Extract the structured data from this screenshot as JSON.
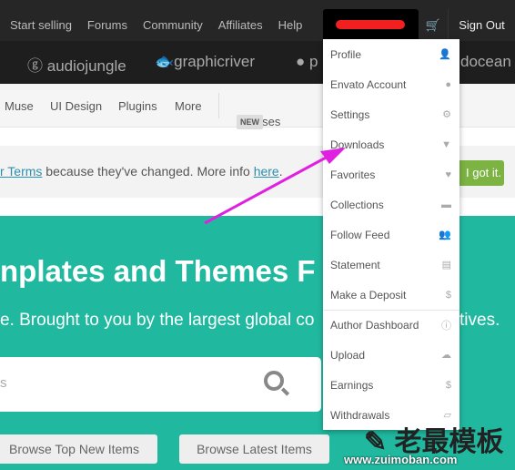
{
  "topbar": {
    "links": [
      "Start selling",
      "Forums",
      "Community",
      "Affiliates",
      "Help"
    ],
    "sign_out": "Sign Out"
  },
  "brands": [
    "audiojungle",
    "graphicriver",
    "p",
    "docean"
  ],
  "nav": {
    "items": [
      "Muse",
      "UI Design",
      "Plugins",
      "More"
    ],
    "courses": "Courses",
    "new_badge": "NEW"
  },
  "notice": {
    "link1": "r Terms",
    "middle": " because they've changed. More info ",
    "link2": "here",
    "end": ".",
    "button": "I got it."
  },
  "hero": {
    "title": "nplates and Themes F",
    "subtitle": "e. Brought to you by the largest global co",
    "subtitle_end": "tives.",
    "search_placeholder": "s",
    "btn_top": "Browse Top New Items",
    "btn_latest": "Browse Latest Items"
  },
  "menu": [
    {
      "label": "Profile",
      "icon": "user-icon",
      "glyph": "👤"
    },
    {
      "label": "Envato Account",
      "icon": "leaf-icon",
      "glyph": "●"
    },
    {
      "label": "Settings",
      "icon": "gear-icon",
      "glyph": "⚙"
    },
    {
      "label": "Downloads",
      "icon": "download-icon",
      "glyph": "▼"
    },
    {
      "label": "Favorites",
      "icon": "heart-icon",
      "glyph": "♥"
    },
    {
      "label": "Collections",
      "icon": "folder-icon",
      "glyph": "▬"
    },
    {
      "label": "Follow Feed",
      "icon": "follow-icon",
      "glyph": "👥"
    },
    {
      "label": "Statement",
      "icon": "statement-icon",
      "glyph": "▤"
    },
    {
      "label": "Make a Deposit",
      "icon": "dollar-icon",
      "glyph": "$"
    },
    {
      "label": "Author Dashboard",
      "icon": "info-icon",
      "glyph": "ⓘ"
    },
    {
      "label": "Upload",
      "icon": "cloud-upload-icon",
      "glyph": "☁"
    },
    {
      "label": "Earnings",
      "icon": "money-bag-icon",
      "glyph": "$"
    },
    {
      "label": "Withdrawals",
      "icon": "withdraw-icon",
      "glyph": "▱"
    }
  ],
  "watermark": {
    "text": "老最模板",
    "url": "www.zuimoban.com"
  },
  "colors": {
    "accent": "#20b9a0",
    "button_green": "#7cb342",
    "arrow": "#e020e0"
  }
}
